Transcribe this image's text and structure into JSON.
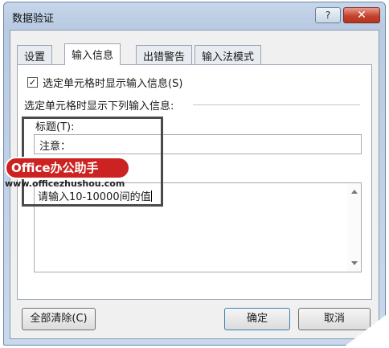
{
  "window": {
    "title": "数据验证",
    "help_label": "?",
    "close_label": "✕"
  },
  "tabs": [
    {
      "label": "设置",
      "active": false
    },
    {
      "label": "输入信息",
      "active": true
    },
    {
      "label": "出错警告",
      "active": false
    },
    {
      "label": "输入法模式",
      "active": false
    }
  ],
  "panel": {
    "show_checkbox_label": "选定单元格时显示输入信息(S)",
    "show_checkbox_checked": true,
    "group_label": "选定单元格时显示下列输入信息:",
    "title_label": "标题(T):",
    "title_value": "注意：",
    "message_value": "请输入10-10000间的值"
  },
  "watermark": {
    "brand": "Office办公助手",
    "url": "www.officezhushou.com"
  },
  "buttons": {
    "clear": "全部清除(C)",
    "ok": "确定",
    "cancel": "取消"
  },
  "colors": {
    "accent_watermark": "#cc2222",
    "titlebar": "#c6d6ea",
    "close": "#c5432e"
  }
}
